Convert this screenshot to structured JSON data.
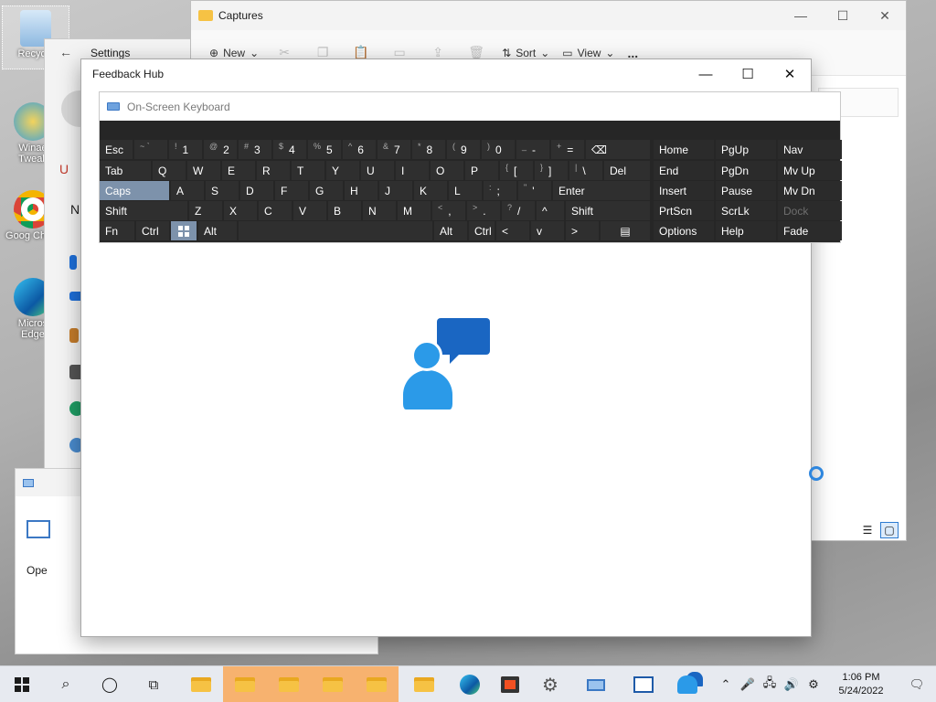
{
  "desktop": {
    "icons": [
      {
        "label": "Recycle"
      },
      {
        "label": "Winae Tweak"
      },
      {
        "label": "Goog Chron"
      },
      {
        "label": "Micros Edge"
      }
    ]
  },
  "explorer": {
    "title": "Captures",
    "toolbar": {
      "new_label": "New",
      "sort_label": "Sort",
      "view_label": "View",
      "more_label": "..."
    }
  },
  "settings": {
    "title": "Settings",
    "fragments": {
      "a": "U",
      "b": "N"
    }
  },
  "mini": {
    "fragment": "Ope"
  },
  "feedback": {
    "title": "Feedback Hub"
  },
  "osk": {
    "title": "On-Screen Keyboard",
    "rows": [
      [
        {
          "k": "Esc"
        },
        {
          "s": "~ `",
          "k": ""
        },
        {
          "s": "!",
          "k": "1"
        },
        {
          "s": "@",
          "k": "2"
        },
        {
          "s": "#",
          "k": "3"
        },
        {
          "s": "$",
          "k": "4"
        },
        {
          "s": "%",
          "k": "5"
        },
        {
          "s": "^",
          "k": "6"
        },
        {
          "s": "&",
          "k": "7"
        },
        {
          "s": "*",
          "k": "8"
        },
        {
          "s": "(",
          "k": "9"
        },
        {
          "s": ")",
          "k": "0"
        },
        {
          "s": "_",
          "k": "-"
        },
        {
          "s": "+",
          "k": "="
        },
        {
          "k": "⌫"
        }
      ],
      [
        {
          "k": "Tab"
        },
        {
          "k": "Q"
        },
        {
          "k": "W"
        },
        {
          "k": "E"
        },
        {
          "k": "R"
        },
        {
          "k": "T"
        },
        {
          "k": "Y"
        },
        {
          "k": "U"
        },
        {
          "k": "I"
        },
        {
          "k": "O"
        },
        {
          "k": "P"
        },
        {
          "s": "{",
          "k": "["
        },
        {
          "s": "}",
          "k": "]"
        },
        {
          "s": "|",
          "k": "\\"
        },
        {
          "k": "Del"
        }
      ],
      [
        {
          "k": "Caps"
        },
        {
          "k": "A"
        },
        {
          "k": "S"
        },
        {
          "k": "D"
        },
        {
          "k": "F"
        },
        {
          "k": "G"
        },
        {
          "k": "H"
        },
        {
          "k": "J"
        },
        {
          "k": "K"
        },
        {
          "k": "L"
        },
        {
          "s": ":",
          "k": ";"
        },
        {
          "s": "\"",
          "k": "'"
        },
        {
          "k": "Enter"
        }
      ],
      [
        {
          "k": "Shift"
        },
        {
          "k": "Z"
        },
        {
          "k": "X"
        },
        {
          "k": "C"
        },
        {
          "k": "V"
        },
        {
          "k": "B"
        },
        {
          "k": "N"
        },
        {
          "k": "M"
        },
        {
          "s": "<",
          "k": ","
        },
        {
          "s": ">",
          "k": "."
        },
        {
          "s": "?",
          "k": "/"
        },
        {
          "k": "^"
        },
        {
          "k": "Shift"
        }
      ],
      [
        {
          "k": "Fn"
        },
        {
          "k": "Ctrl"
        },
        {
          "k": "win"
        },
        {
          "k": "Alt"
        },
        {
          "k": ""
        },
        {
          "k": "Alt"
        },
        {
          "k": "Ctrl"
        },
        {
          "k": "<"
        },
        {
          "k": "v"
        },
        {
          "k": ">"
        },
        {
          "k": "menu"
        }
      ]
    ],
    "nav": [
      [
        "Home",
        "PgUp",
        "Nav"
      ],
      [
        "End",
        "PgDn",
        "Mv Up"
      ],
      [
        "Insert",
        "Pause",
        "Mv Dn"
      ],
      [
        "PrtScn",
        "ScrLk",
        "Dock"
      ],
      [
        "Options",
        "Help",
        "Fade"
      ]
    ]
  },
  "taskbar": {
    "time": "1:06 PM",
    "date": "5/24/2022"
  }
}
